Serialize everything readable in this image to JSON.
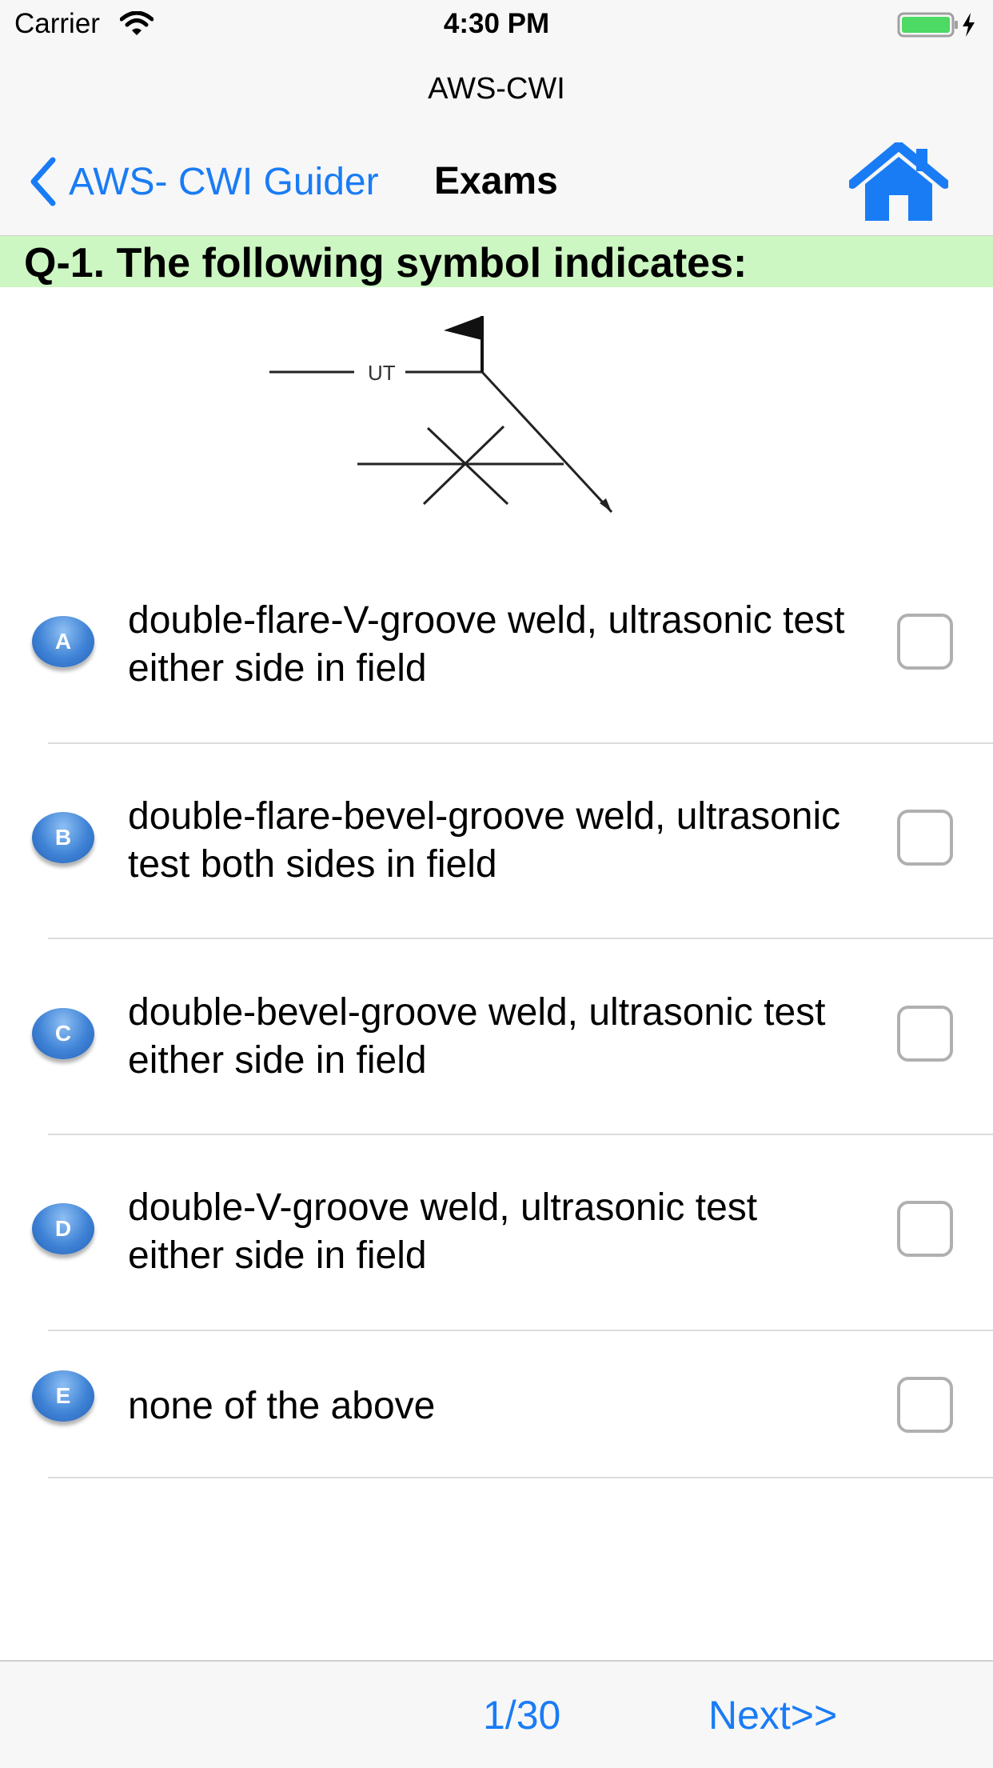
{
  "status_bar": {
    "carrier": "Carrier",
    "time": "4:30 PM"
  },
  "nav": {
    "app_title": "AWS-CWI",
    "back_label": "AWS- CWI Guider",
    "title": "Exams",
    "home_icon": "home-icon",
    "accent_color": "#1a7cf5"
  },
  "question": {
    "text": "Q-1. The following symbol indicates:",
    "background_color": "#ccf6c2",
    "figure": {
      "label": "UT"
    }
  },
  "options": [
    {
      "letter": "A",
      "text": "double-flare-V-groove weld, ultrasonic test either side in field",
      "checked": false
    },
    {
      "letter": "B",
      "text": "double-flare-bevel-groove weld, ultrasonic test both sides in field",
      "checked": false
    },
    {
      "letter": "C",
      "text": "double-bevel-groove weld, ultrasonic test either side in field",
      "checked": false
    },
    {
      "letter": "D",
      "text": "double-V-groove weld, ultrasonic test either side in field",
      "checked": false
    },
    {
      "letter": "E",
      "text": "none of the above",
      "checked": false
    }
  ],
  "footer": {
    "counter": "1/30",
    "next_label": "Next>>"
  }
}
